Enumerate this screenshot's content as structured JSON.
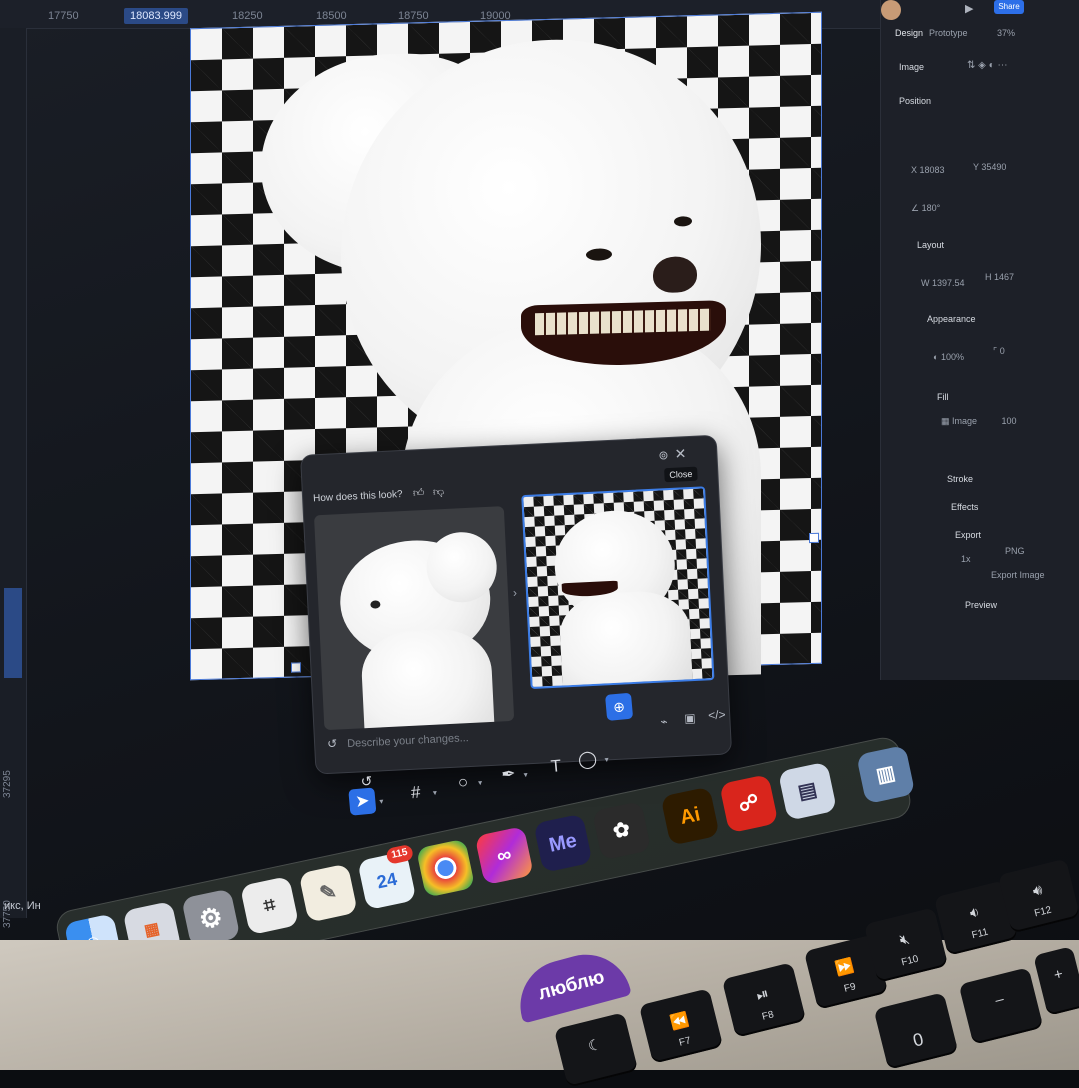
{
  "ruler": {
    "top_ticks": [
      "17750",
      "18083.999",
      "18250",
      "18500",
      "18750",
      "19000"
    ],
    "left_ticks": [
      "37295",
      "37750"
    ]
  },
  "canvas": {
    "bottom_left_text": "икс, Ин"
  },
  "right_panel": {
    "tabs": [
      "Design",
      "Prototype"
    ],
    "zoom": "37%",
    "share_label": "Share",
    "section_image": "Image",
    "section_position": "Position",
    "position_x": "18083",
    "position_y": "35490",
    "rotation": "180°",
    "section_layout": "Layout",
    "width": "1397.54",
    "height": "1467",
    "section_appearance": "Appearance",
    "opacity": "100%",
    "radius": "0",
    "section_fill": "Fill",
    "fill_type": "Image",
    "fill_opacity": "100",
    "section_stroke": "Stroke",
    "section_effects": "Effects",
    "section_export": "Export",
    "export_scale": "1x",
    "export_format": "PNG",
    "export_button": "Export Image",
    "section_preview": "Preview"
  },
  "ai_popup": {
    "question": "How does this look?",
    "close_tooltip": "Close",
    "prompt_placeholder": "Describe your changes..."
  },
  "dock": {
    "calendar_day": "24",
    "calendar_badge": "115",
    "illustrator_label": "Ai",
    "media_encoder_label": "Me"
  },
  "keyboard": {
    "keys": [
      "F7",
      "F8",
      "F9",
      "F10",
      "F11",
      "F12"
    ],
    "zero": "0"
  },
  "sticker_text": "люблю"
}
